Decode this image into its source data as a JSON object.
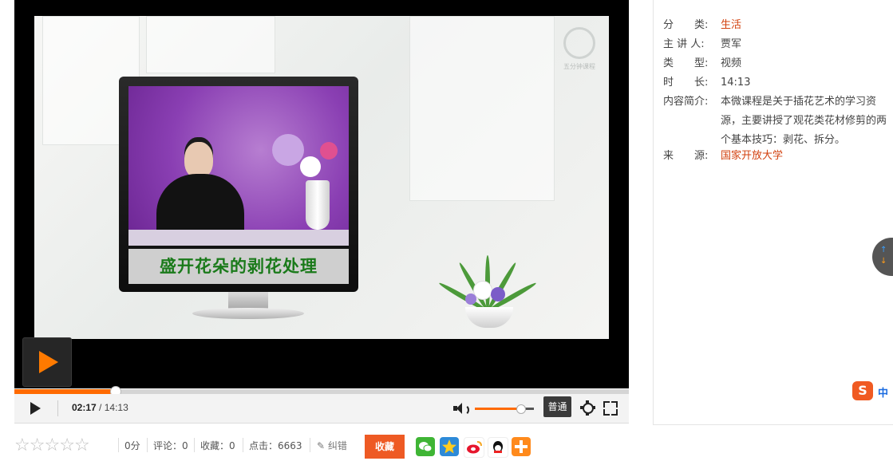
{
  "video": {
    "caption": "盛开花朵的剥花处理",
    "logo_text": "五分钟课程",
    "current_time": "02:17",
    "time_separator": "/",
    "total_time": "14:13",
    "progress_fraction": 0.165,
    "volume_fraction": 0.78,
    "quality_label": "普通"
  },
  "actions": {
    "score": "0分",
    "comments": "评论：0",
    "favorites": "收藏：0",
    "clicks": "点击：6663",
    "report": "纠错",
    "favorite_button": "收藏",
    "share_targets": [
      "wechat-share-icon",
      "qzone-share-icon",
      "weibo-share-icon",
      "qq-share-icon",
      "more-share-icon"
    ],
    "star_count": 5,
    "rating": 0
  },
  "info": {
    "category_label": "分　　类:",
    "category_value": "生活",
    "speaker_label": "主 讲 人:",
    "speaker_value": "贾军",
    "type_label": "类　　型:",
    "type_value": "视频",
    "duration_label": "时　　长:",
    "duration_value": "14:13",
    "intro_label": "内容简介:",
    "intro_value": "本微课程是关于插花艺术的学习资源，主要讲授了观花类花材修剪的两个基本技巧：剥花、拆分。",
    "source_label": "来　　源:",
    "source_value": "国家开放大学"
  },
  "widgets": {
    "ime_logo": "S",
    "ime_text": "中"
  },
  "colors": {
    "accent": "#ff6a00",
    "link": "#d2400e",
    "favorite_button": "#ee5a24",
    "caption_text": "#1a7a1a"
  }
}
